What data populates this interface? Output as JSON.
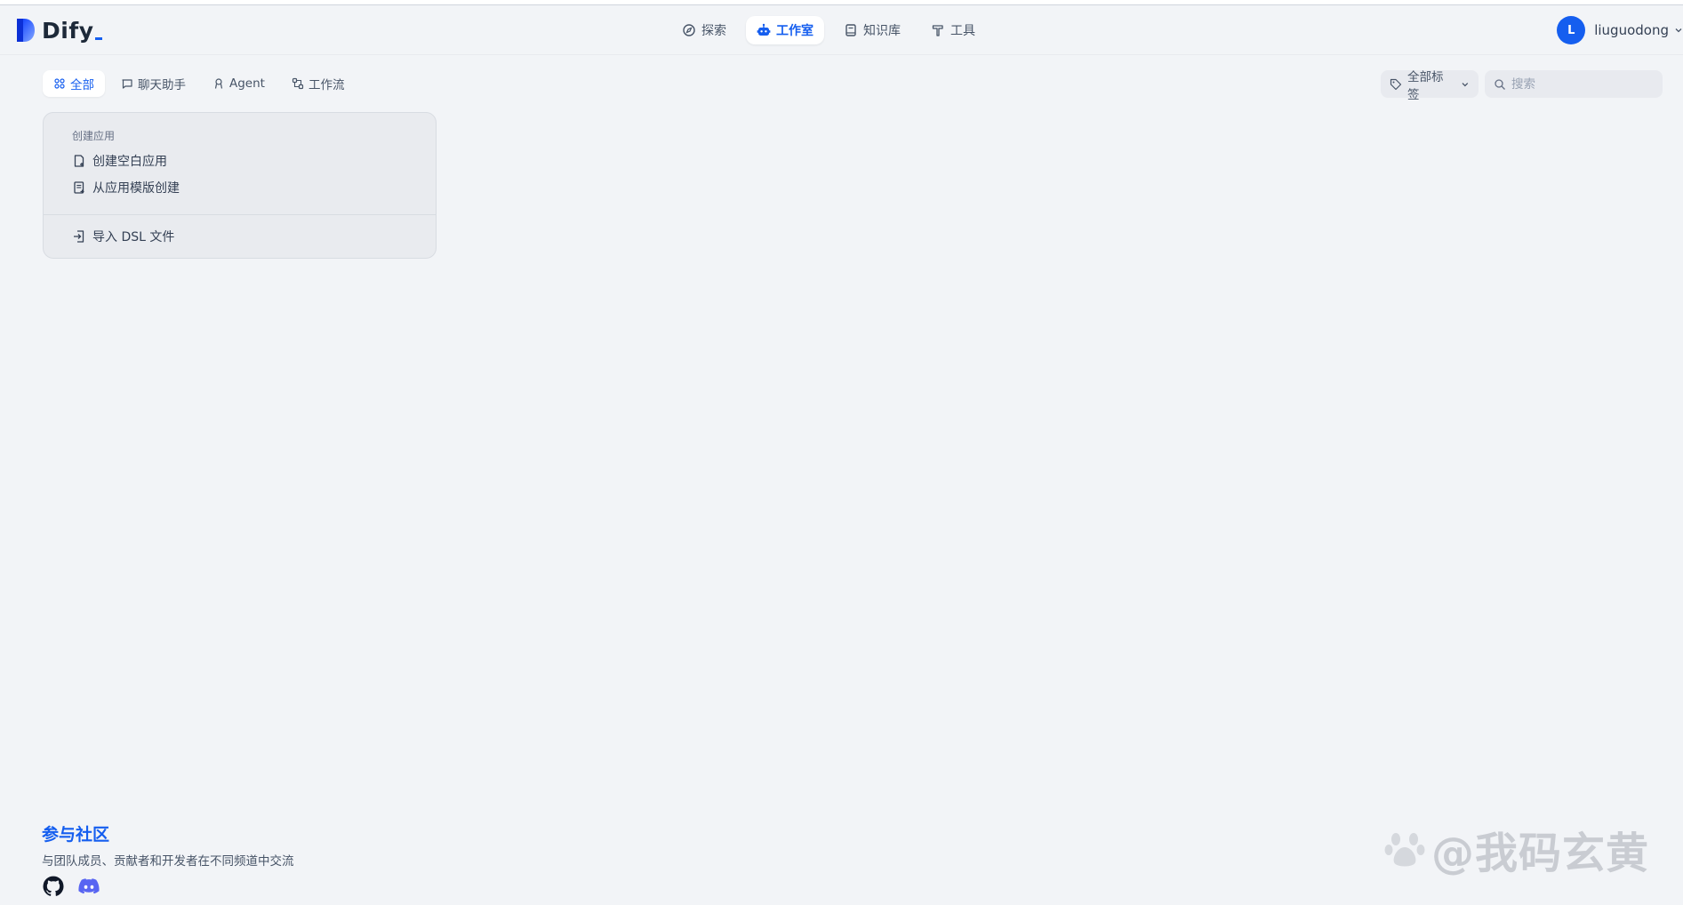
{
  "brand": {
    "name": "Dify"
  },
  "nav": {
    "items": [
      {
        "label": "探索",
        "icon": "compass-icon",
        "active": false
      },
      {
        "label": "工作室",
        "icon": "robot-icon",
        "active": true
      },
      {
        "label": "知识库",
        "icon": "book-icon",
        "active": false
      },
      {
        "label": "工具",
        "icon": "hammer-icon",
        "active": false
      }
    ]
  },
  "user": {
    "initial": "L",
    "name": "liuguodong"
  },
  "tabs": [
    {
      "label": "全部",
      "icon": "grid-icon",
      "active": true
    },
    {
      "label": "聊天助手",
      "icon": "chat-icon",
      "active": false
    },
    {
      "label": "Agent",
      "icon": "agent-icon",
      "active": false
    },
    {
      "label": "工作流",
      "icon": "workflow-icon",
      "active": false
    }
  ],
  "filters": {
    "tag_label": "全部标签",
    "search_placeholder": "搜索"
  },
  "create_card": {
    "title": "创建应用",
    "blank": "创建空白应用",
    "template": "从应用模版创建",
    "import": "导入 DSL 文件"
  },
  "community": {
    "title": "参与社区",
    "desc": "与团队成员、贡献者和开发者在不同频道中交流"
  },
  "watermark": {
    "text": "@我码玄黄"
  },
  "colors": {
    "accent": "#155eef",
    "background": "#f2f4f7"
  }
}
